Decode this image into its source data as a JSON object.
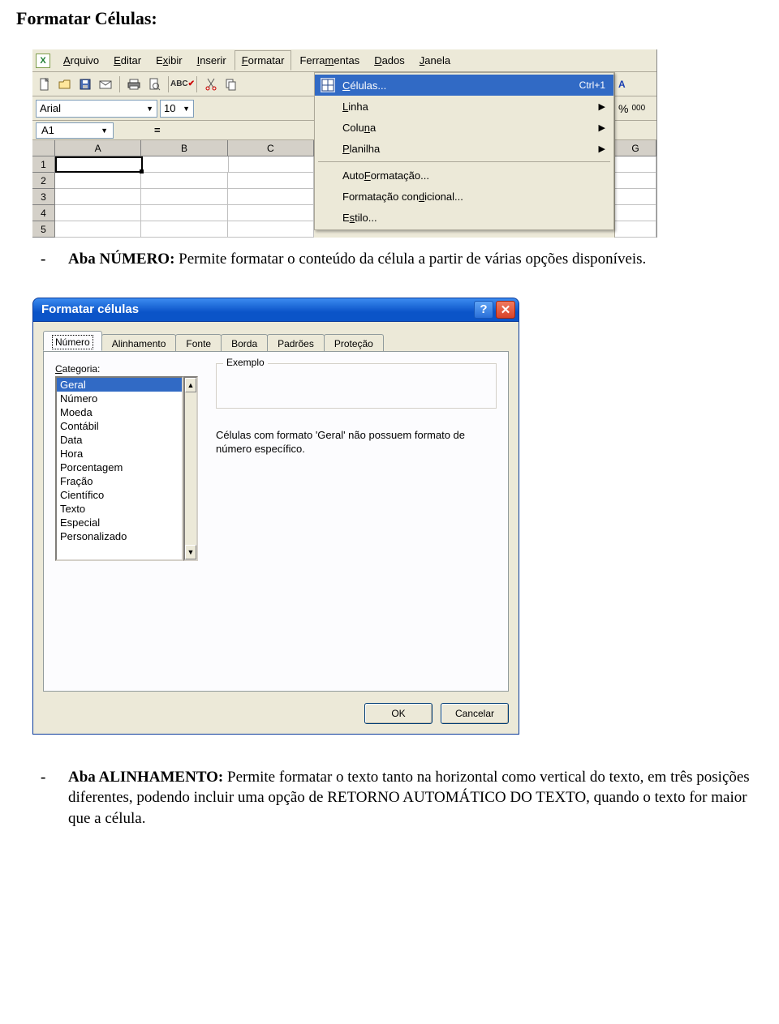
{
  "doc": {
    "heading": "Formatar Células:",
    "bullet1_label": "Aba NÚMERO:",
    "bullet1_text": " Permite formatar o conteúdo da célula a partir de várias opções disponíveis.",
    "bullet2_label": "Aba ALINHAMENTO:",
    "bullet2_text": " Permite formatar o texto tanto na horizontal como vertical do texto, em três posições diferentes, podendo incluir uma opção de RETORNO AUTOMÁTICO DO TEXTO, quando o texto for maior que a célula."
  },
  "excel": {
    "app_icon_text": "X",
    "menus": {
      "arquivo": "Arquivo",
      "editar": "Editar",
      "exibir": "Exibir",
      "inserir": "Inserir",
      "formatar": "Formatar",
      "ferramentas": "Ferramentas",
      "dados": "Dados",
      "janela": "Janela"
    },
    "menus_ul": {
      "arquivo": "A",
      "editar": "E",
      "exibir": "x",
      "inserir": "I",
      "formatar": "F",
      "ferramentas": "m",
      "dados": "D",
      "janela": "J"
    },
    "font_name": "Arial",
    "font_size": "10",
    "namebox": "A1",
    "fx_eq": "=",
    "columns": [
      "A",
      "B",
      "C"
    ],
    "right_col_header": "G",
    "rows": [
      "1",
      "2",
      "3",
      "4",
      "5"
    ],
    "dropdown": {
      "celulas": "Células...",
      "celulas_shortcut": "Ctrl+1",
      "linha": "Linha",
      "coluna": "Coluna",
      "planilha": "Planilha",
      "autoformatacao": "AutoFormatação...",
      "condicional": "Formatação condicional...",
      "estilo": "Estilo..."
    },
    "right_tools": {
      "sort": "A↕Z",
      "pct": "%",
      "zeros": "000"
    }
  },
  "dialog": {
    "title": "Formatar células",
    "tabs": {
      "numero": "Número",
      "alinhamento": "Alinhamento",
      "fonte": "Fonte",
      "borda": "Borda",
      "padroes": "Padrões",
      "protecao": "Proteção"
    },
    "categoria_label": "Categoria:",
    "categories": [
      "Geral",
      "Número",
      "Moeda",
      "Contábil",
      "Data",
      "Hora",
      "Porcentagem",
      "Fração",
      "Científico",
      "Texto",
      "Especial",
      "Personalizado"
    ],
    "exemplo_label": "Exemplo",
    "desc": "Células com formato 'Geral' não possuem formato de número específico.",
    "ok": "OK",
    "cancel": "Cancelar"
  }
}
